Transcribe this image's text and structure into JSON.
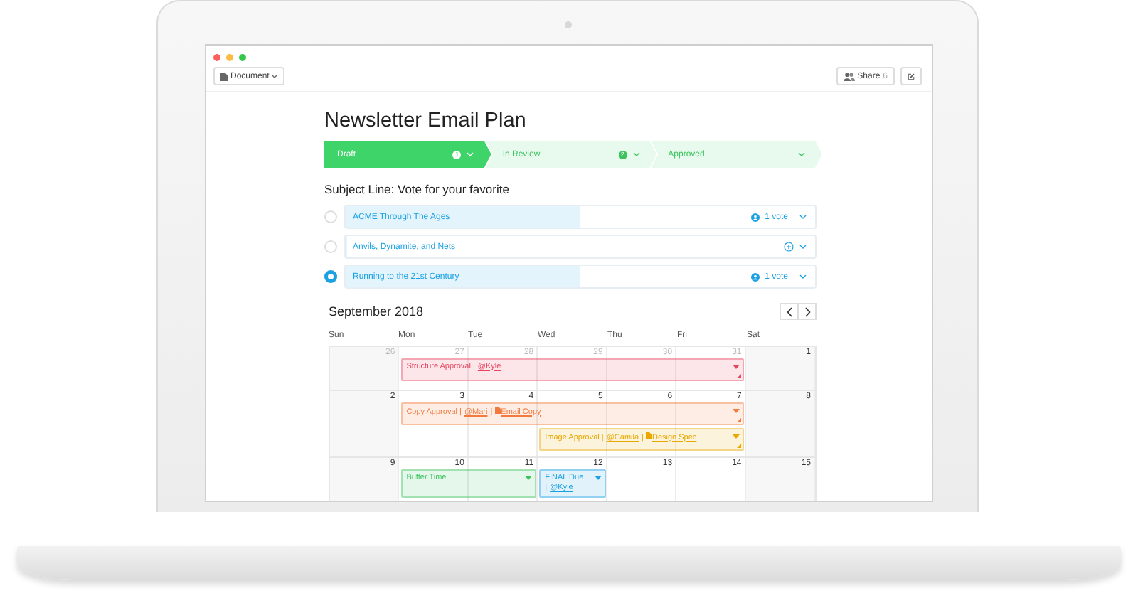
{
  "toolbar": {
    "document_menu": "Document",
    "share_label": "Share",
    "share_count": "6"
  },
  "title": "Newsletter Email Plan",
  "stages": [
    {
      "label": "Draft",
      "count": "1",
      "selected": true
    },
    {
      "label": "In Review",
      "count": "2",
      "selected": false
    },
    {
      "label": "Approved",
      "selected": false
    }
  ],
  "subject_heading": "Subject Line: Vote for your favorite",
  "options": [
    {
      "label": "ACME Through The Ages",
      "votes": "1 vote",
      "level": 0.5,
      "selected": false
    },
    {
      "label": "Anvils, Dynamite, and Nets",
      "level": 0,
      "selected": false
    },
    {
      "label": "Running to the 21st Century",
      "votes": "1 vote",
      "level": 0.5,
      "selected": true
    }
  ],
  "calendar": {
    "month": "September 2018",
    "weekdays": [
      "Sun",
      "Mon",
      "Tue",
      "Wed",
      "Thu",
      "Fri",
      "Sat"
    ],
    "weeks": [
      {
        "days": [
          {
            "number": "26",
            "muted": true
          },
          {
            "number": "27",
            "muted": true,
            "events": [
              {
                "title": "Structure Approval |",
                "links": [
                  {
                    "kind": "user",
                    "text": "@Kyle"
                  }
                ],
                "color": "#e8455f",
                "resizable": true
              }
            ]
          },
          {
            "number": "28",
            "muted": true
          },
          {
            "number": "29",
            "muted": true
          },
          {
            "number": "30",
            "muted": true
          },
          {
            "number": "31",
            "muted": true
          },
          {
            "number": "1",
            "muted": false
          }
        ]
      },
      {
        "days": [
          {
            "number": "2",
            "muted": false
          },
          {
            "number": "3",
            "muted": false,
            "events": [
              {
                "title": "Copy Approval |",
                "links": [
                  {
                    "kind": "user",
                    "text": "@Mari",
                    "after": "|"
                  },
                  {
                    "kind": "document",
                    "text": "Email Copy"
                  }
                ],
                "color": "#f27a3c",
                "resizable": true
              }
            ]
          },
          {
            "number": "4",
            "muted": false
          },
          {
            "number": "5",
            "muted": false,
            "events": [
              {
                "title": "Image Approval |",
                "links": [
                  {
                    "kind": "user",
                    "text": "@Camila",
                    "after": "|"
                  },
                  {
                    "kind": "document",
                    "text": "Design Spec"
                  }
                ],
                "color": "#e9a800",
                "resizable": true
              }
            ]
          },
          {
            "number": "6",
            "muted": false
          },
          {
            "number": "7",
            "muted": false
          },
          {
            "number": "8",
            "muted": false
          }
        ]
      },
      {
        "days": [
          {
            "number": "9",
            "muted": false
          },
          {
            "number": "10",
            "muted": false,
            "events": [
              {
                "title": "Buffer Time",
                "color": "#3cc35f",
                "resizable": false
              }
            ]
          },
          {
            "number": "11",
            "muted": false
          },
          {
            "number": "12",
            "muted": false,
            "events": [
              {
                "title": "FINAL Due |",
                "links": [
                  {
                    "kind": "user",
                    "text": "@Kyle"
                  }
                ],
                "color": "#1ba1e2",
                "resizable": false
              }
            ]
          },
          {
            "number": "13",
            "muted": false
          },
          {
            "number": "14",
            "muted": false
          },
          {
            "number": "15",
            "muted": false
          }
        ]
      }
    ]
  }
}
